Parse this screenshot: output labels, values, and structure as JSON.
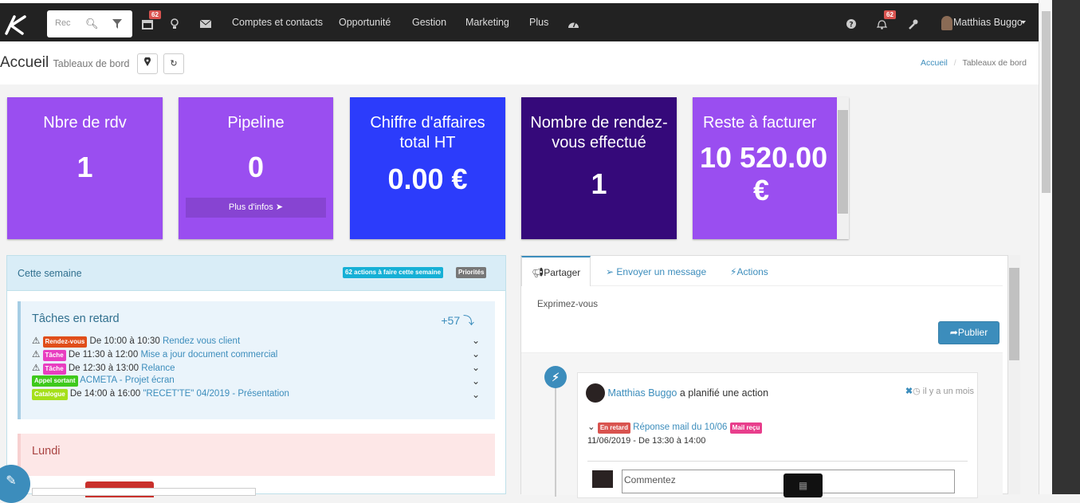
{
  "nav": {
    "search_placeholder": "Rec",
    "calendar_badge": "62",
    "items": [
      "Comptes et contacts",
      "Opportunité",
      "Gestion",
      "Marketing",
      "Plus"
    ],
    "notif_badge": "62",
    "user_name": "Matthias Buggo"
  },
  "header": {
    "title": "Accueil",
    "subtitle": "Tableaux de bord",
    "breadcrumb_home": "Accueil",
    "breadcrumb_sep": "/",
    "breadcrumb_current": "Tableaux de bord"
  },
  "cards": [
    {
      "title": "Nbre de rdv",
      "value": "1",
      "color": "#9a4ef0"
    },
    {
      "title": "Pipeline",
      "value": "0",
      "link": "Plus d'infos",
      "color": "#9a4ef0"
    },
    {
      "title": "Chiffre d'affaires total HT",
      "value": "0.00 €",
      "color": "#2c3cfb"
    },
    {
      "title": "Nombre de rendez-vous effectué",
      "value": "1",
      "color": "#35097a"
    },
    {
      "title": "Reste à facturer",
      "value": "10 520.00",
      "value2": "€",
      "color": "#9a4ef0"
    }
  ],
  "week": {
    "title": "Cette semaine",
    "badge_actions": "62 actions à faire cette semaine",
    "badge_priorites": "Priorités",
    "late_title": "Tâches en retard",
    "late_count": "+57",
    "tasks": [
      {
        "tag": "Rendez-vous",
        "tag_color": "#e04e1a",
        "time": "De 10:00 à 10:30",
        "label": "Rendez vous client",
        "warn": true
      },
      {
        "tag": "Tâche",
        "tag_color": "#e83ec0",
        "time": "De 11:30 à 12:00",
        "label": "Mise a jour document commercial",
        "warn": true
      },
      {
        "tag": "Tâche",
        "tag_color": "#e83ec0",
        "time": "De 12:30 à 13:00",
        "label": "Relance",
        "warn": true
      },
      {
        "tag": "Appel sortant",
        "tag_color": "#3ec91c",
        "time": "",
        "label": "ACMETA - Projet écran",
        "warn": false
      },
      {
        "tag": "Catalogue",
        "tag_color": "#a5e01a",
        "time": "De 14:00 à 16:00",
        "label": "\"RECET'TE\" 04/2019 - Présentation",
        "warn": false
      }
    ],
    "lundi": "Lundi"
  },
  "share": {
    "tab_share": "Partager",
    "tab_message": "Envoyer un message",
    "tab_actions": "Actions",
    "placeholder": "Exprimez-vous",
    "publish": "Publier",
    "post_author": "Matthias Buggo",
    "post_action": "a planifié une action",
    "post_time": "il y a un mois",
    "late_label": "En retard",
    "reply_link": "Réponse mail du 10/06",
    "mail_label": "Mail reçu",
    "reply_date": "11/06/2019 - De 13:30 à 14:00",
    "comment_placeholder": "Commentez"
  }
}
